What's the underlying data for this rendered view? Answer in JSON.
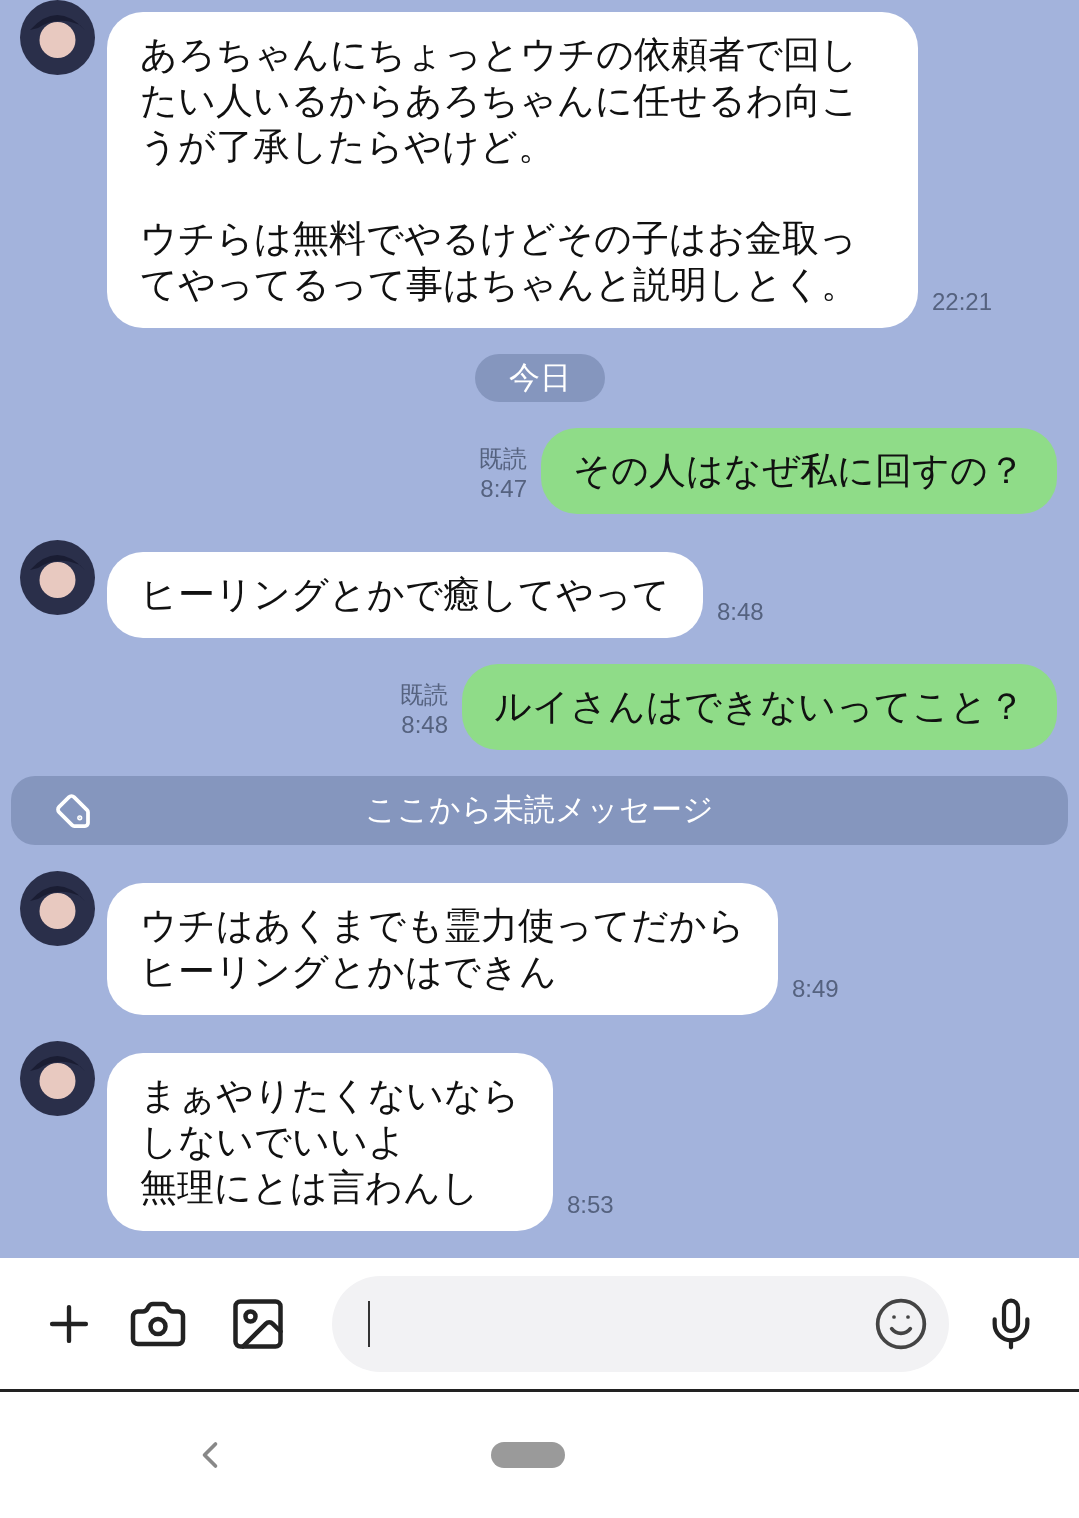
{
  "messages": [
    {
      "kind": "incoming",
      "paragraphs": [
        "あろちゃんにちょっとウチの依頼者で回したい人いるからあろちゃんに任せるわ向こうが了承したらやけど。",
        "ウチらは無料でやるけどその子はお金取ってやってるって事はちゃんと説明しとく。"
      ],
      "time": "22:21"
    },
    {
      "kind": "date",
      "text": "今日"
    },
    {
      "kind": "outgoing",
      "lines": [
        "その人はなぜ私に回すの？"
      ],
      "read_label": "既読",
      "time": "8:47"
    },
    {
      "kind": "incoming",
      "lines": [
        "ヒーリングとかで癒してやって"
      ],
      "time": "8:48"
    },
    {
      "kind": "outgoing",
      "lines": [
        "ルイさんはできないってこと？"
      ],
      "read_label": "既読",
      "time": "8:48"
    },
    {
      "kind": "unread_divider",
      "text": "ここから未読メッセージ"
    },
    {
      "kind": "incoming",
      "lines": [
        "ウチはあくまでも霊力使ってだから",
        "ヒーリングとかはできん"
      ],
      "time": "8:49"
    },
    {
      "kind": "incoming",
      "lines": [
        "まぁやりたくないなら",
        "しないでいいよ",
        "無理にとは言わんし"
      ],
      "time": "8:53"
    }
  ]
}
